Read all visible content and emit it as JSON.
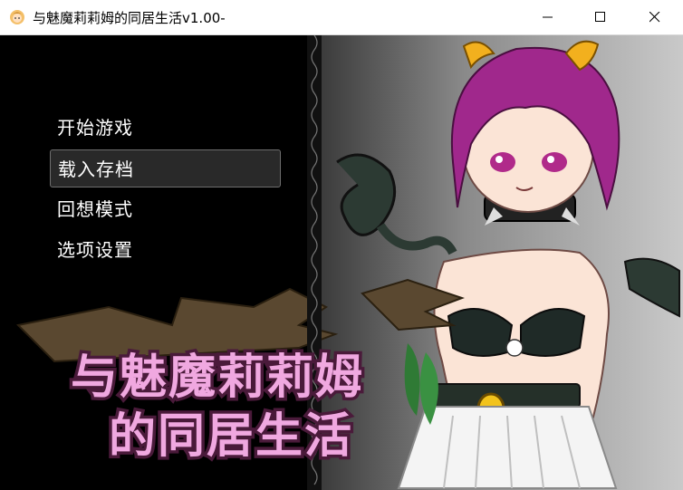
{
  "window": {
    "title": "与魅魔莉莉姆的同居生活v1.00-",
    "icon": "app-icon-face"
  },
  "controls": {
    "minimize_icon": "minimize-icon",
    "maximize_icon": "maximize-icon",
    "close_icon": "close-icon"
  },
  "menu": {
    "items": [
      {
        "label": "开始游戏",
        "selected": false
      },
      {
        "label": "载入存档",
        "selected": true
      },
      {
        "label": "回想模式",
        "selected": false
      },
      {
        "label": "选项设置",
        "selected": false
      }
    ]
  },
  "logo": {
    "line1": "与魅魔莉莉姆",
    "line2": "的同居生活"
  },
  "colors": {
    "menu_bg": "#000000",
    "menu_text": "#ffffff",
    "logo_fill": "#f0a8e0",
    "logo_outline": "#4a1a3a",
    "hair": "#a0288c",
    "horn": "#f2b01e"
  }
}
